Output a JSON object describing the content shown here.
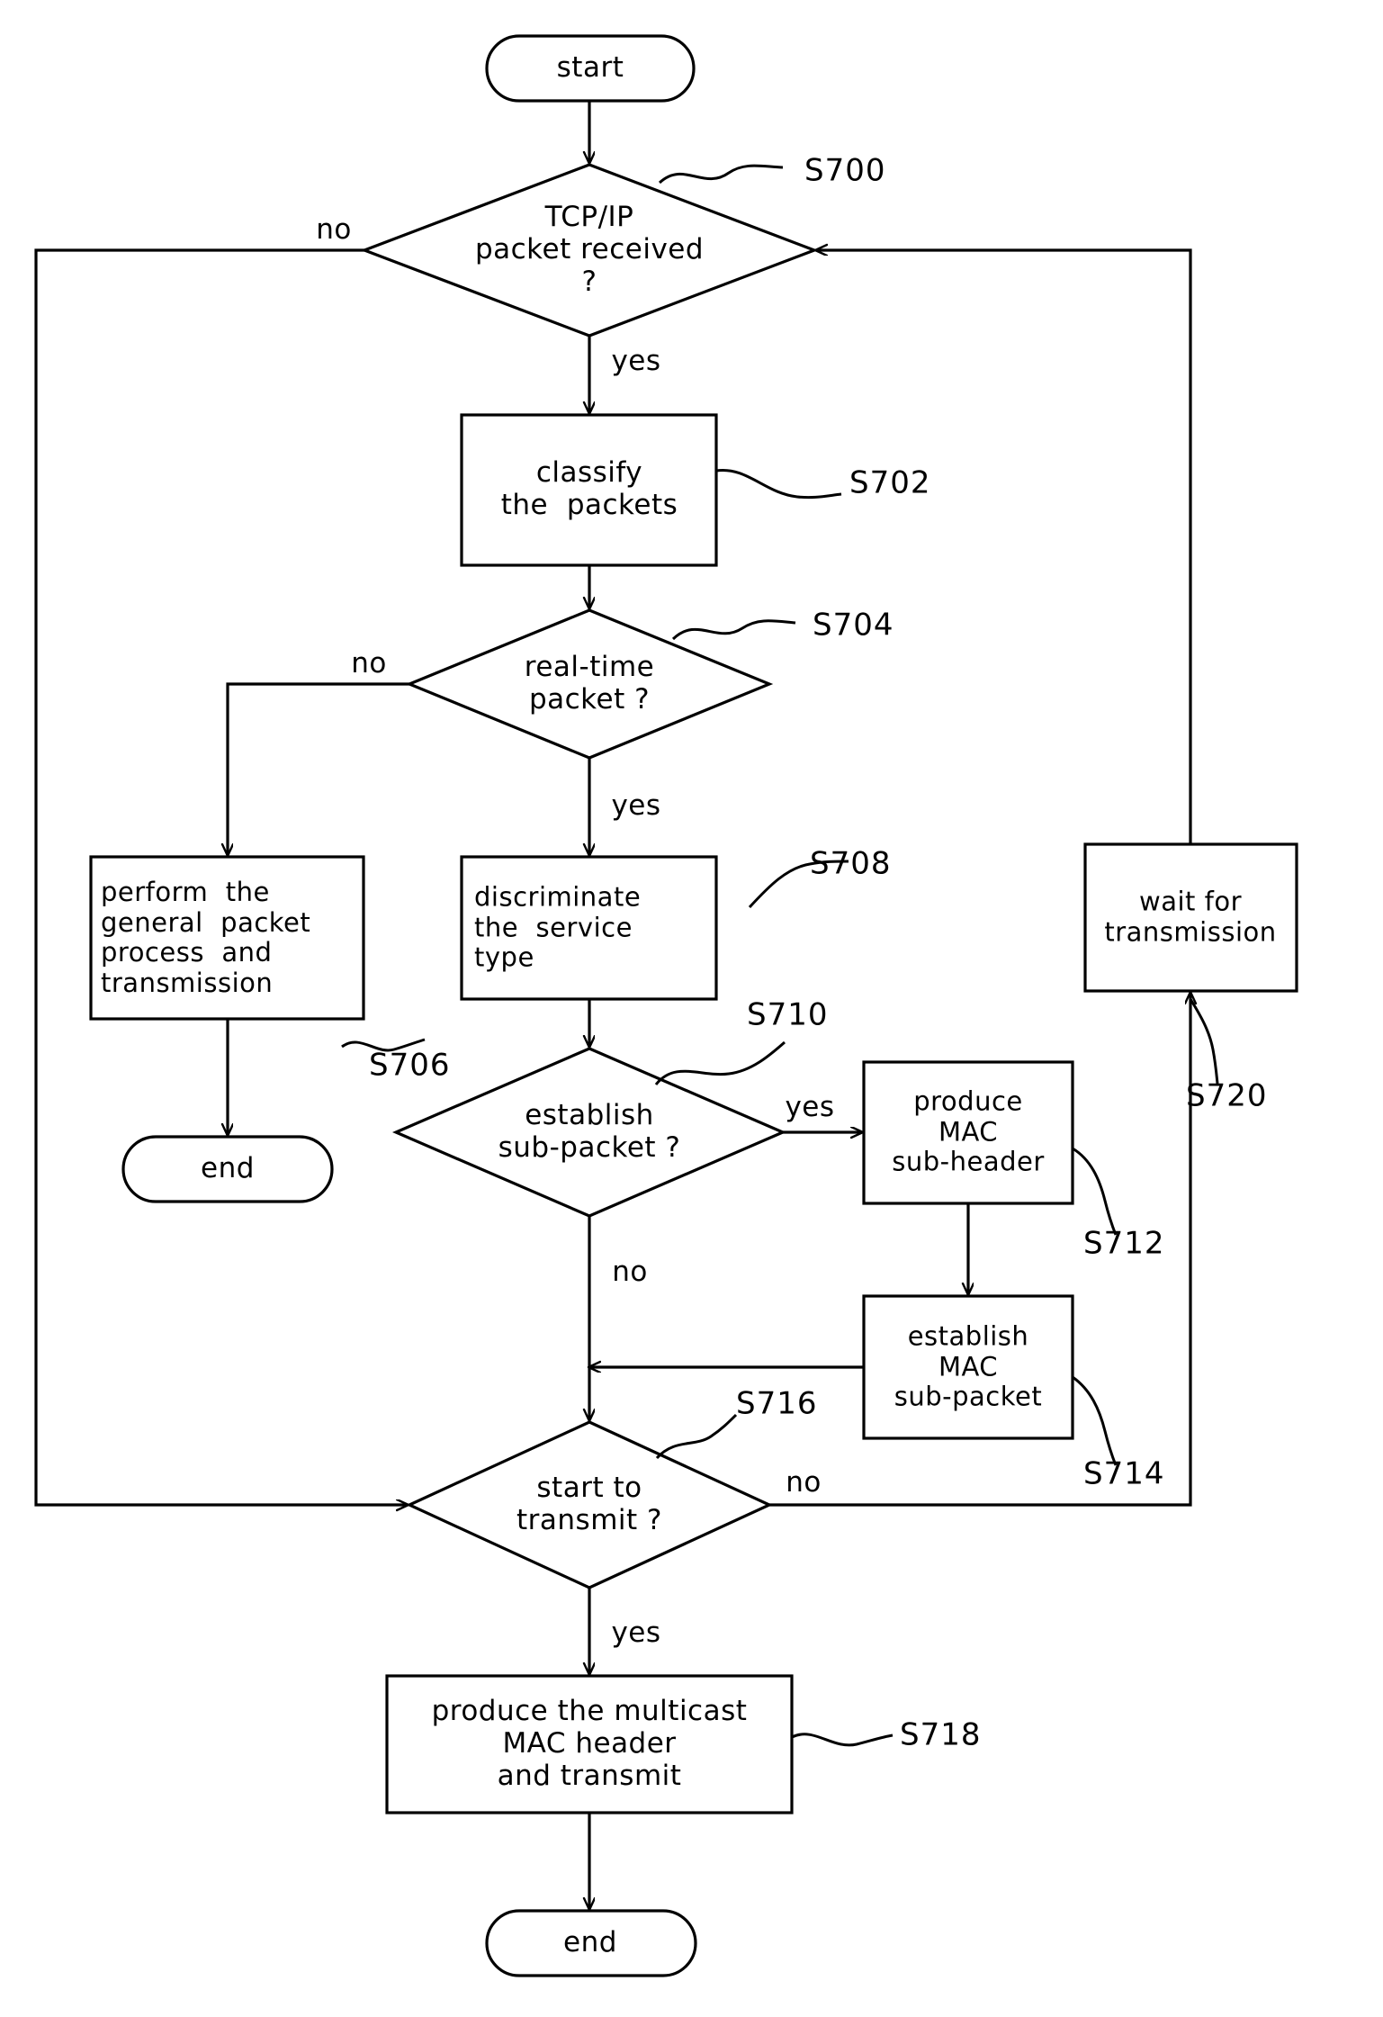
{
  "diagram": {
    "type": "flowchart",
    "title": "TCP/IP multicast MAC packet transmission flow",
    "stroke_color": "#000000",
    "background_color": "#ffffff"
  },
  "nodes": {
    "start": {
      "label": "start",
      "shape": "terminator"
    },
    "s700": {
      "label": "TCP/IP\npacket received\n?",
      "shape": "decision",
      "ref": "S700"
    },
    "s702": {
      "label": "classify\nthe  packets",
      "shape": "process",
      "ref": "S702"
    },
    "s704": {
      "label": "real-time\npacket ?",
      "shape": "decision",
      "ref": "S704"
    },
    "s706": {
      "label": "perform  the\ngeneral  packet\nprocess  and\ntransmission",
      "shape": "process",
      "ref": "S706"
    },
    "end_left": {
      "label": "end",
      "shape": "terminator"
    },
    "s708": {
      "label": "discriminate\nthe  service\ntype",
      "shape": "process",
      "ref": "S708"
    },
    "s710": {
      "label": "establish\nsub-packet ?",
      "shape": "decision",
      "ref": "S710"
    },
    "s712": {
      "label": "produce\nMAC\nsub-header",
      "shape": "process",
      "ref": "S712"
    },
    "s714": {
      "label": "establish\nMAC\nsub-packet",
      "shape": "process",
      "ref": "S714"
    },
    "s716": {
      "label": "start to\ntransmit ?",
      "shape": "decision",
      "ref": "S716"
    },
    "s718": {
      "label": "produce the multicast\nMAC header\nand transmit",
      "shape": "process",
      "ref": "S718"
    },
    "s720": {
      "label": "wait for\ntransmission",
      "shape": "process",
      "ref": "S720"
    },
    "end_bottom": {
      "label": "end",
      "shape": "terminator"
    }
  },
  "ref_labels": {
    "s700": "S700",
    "s702": "S702",
    "s704": "S704",
    "s706": "S706",
    "s708": "S708",
    "s710": "S710",
    "s712": "S712",
    "s714": "S714",
    "s716": "S716",
    "s718": "S718",
    "s720": "S720"
  },
  "edge_labels": {
    "s700_no": "no",
    "s700_yes": "yes",
    "s704_no": "no",
    "s704_yes": "yes",
    "s710_yes": "yes",
    "s710_no": "no",
    "s716_no": "no",
    "s716_yes": "yes"
  }
}
